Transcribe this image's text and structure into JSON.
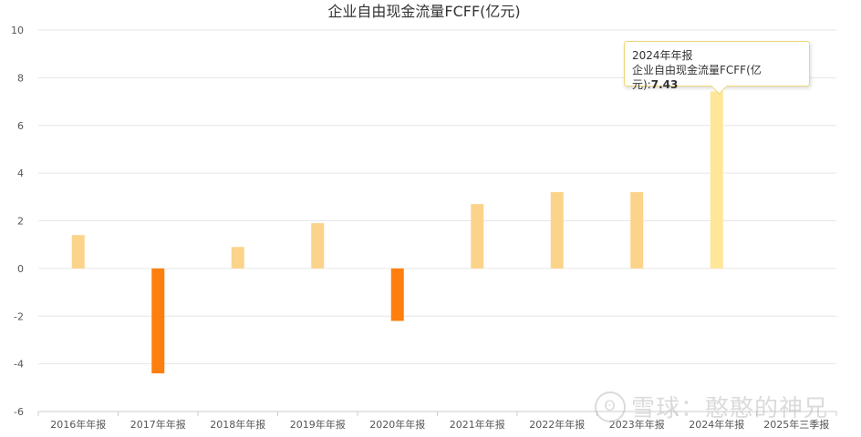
{
  "chart_data": {
    "type": "bar",
    "title": "企业自由现金流量FCFF(亿元)",
    "categories": [
      "2016年年报",
      "2017年年报",
      "2018年年报",
      "2019年年报",
      "2020年年报",
      "2021年年报",
      "2022年年报",
      "2023年年报",
      "2024年年报",
      "2025年三季报"
    ],
    "values": [
      1.4,
      -4.4,
      0.9,
      1.9,
      -2.2,
      2.7,
      3.2,
      3.2,
      7.43,
      null
    ],
    "ylim": [
      -6,
      10
    ],
    "yticks": [
      "10",
      "8",
      "6",
      "4",
      "2",
      "0",
      "-2",
      "-4",
      "-6"
    ],
    "grid": true,
    "colors": {
      "positive": "#fbd38a",
      "negative": "#ff7f0e",
      "highlight": "#ffe699"
    }
  },
  "tooltip": {
    "line1": "2024年年报",
    "label": "企业自由现金流量FCFF(亿元):",
    "value": "7.43"
  },
  "watermark": {
    "logo": "ʘ",
    "text": "雪球：憨憨的神兄"
  }
}
